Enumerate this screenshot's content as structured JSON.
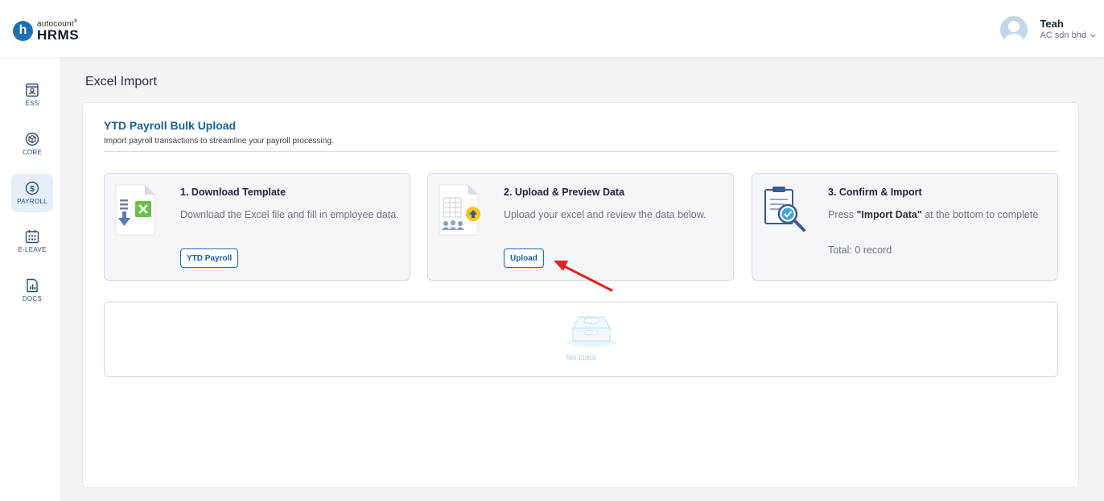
{
  "brand": {
    "small": "autocount",
    "mark": "®",
    "big": "HRMS",
    "letter": "h"
  },
  "user": {
    "name": "Teah",
    "company": "AC sdn bhd",
    "dropdown_icon": "chevron-down-icon"
  },
  "sidebar": {
    "items": [
      {
        "label": "ESS",
        "icon": "id-badge-icon"
      },
      {
        "label": "CORE",
        "icon": "cube-icon"
      },
      {
        "label": "PAYROLL",
        "icon": "dollar-circle-icon"
      },
      {
        "label": "E-LEAVE",
        "icon": "calendar-icon"
      },
      {
        "label": "DOCS",
        "icon": "document-chart-icon"
      }
    ],
    "active": "PAYROLL"
  },
  "page": {
    "title": "Excel Import",
    "section_title": "YTD Payroll Bulk Upload",
    "section_subtitle": "Import payroll transactions to streamline your payroll processing."
  },
  "steps": [
    {
      "title": "1. Download Template",
      "description": "Download the Excel file and fill in employee data.",
      "button": "YTD Payroll",
      "icon": "excel-download-icon"
    },
    {
      "title": "2. Upload & Preview Data",
      "description": "Upload your excel and review the data below.",
      "button": "Upload",
      "icon": "upload-sheet-icon"
    },
    {
      "title": "3. Confirm & Import",
      "description_before": "Press ",
      "description_bold": "\"Import Data\"",
      "description_after": " at the bottom to complete",
      "total": "Total: 0 record",
      "icon": "clipboard-check-icon"
    }
  ],
  "table": {
    "empty_text": "No Data",
    "empty_icon": "empty-box-icon"
  },
  "colors": {
    "accent": "#1a5f98",
    "annotation_arrow": "#e02424",
    "excel_green": "#6cc04a",
    "upload_yellow": "#f5c518"
  }
}
